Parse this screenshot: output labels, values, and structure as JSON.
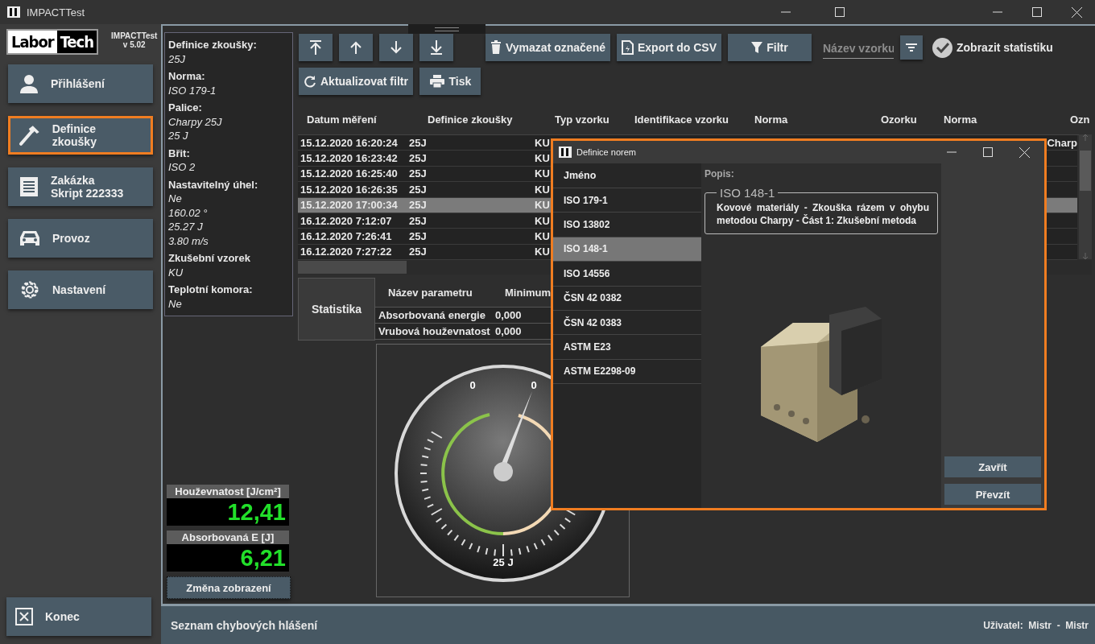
{
  "window": {
    "title": "IMPACTTest"
  },
  "sidebar": {
    "logo": {
      "part1": "Labor",
      "part2": "Tech"
    },
    "app_name": "IMPACTTest",
    "version": "v 5.02",
    "items": [
      {
        "label": "Přihlášení",
        "kind": "user",
        "highlighted": false
      },
      {
        "label": "Definice zkoušky",
        "kind": "hammer",
        "highlighted": true
      },
      {
        "label": "Zakázka",
        "sublabel": "Skript 222333",
        "kind": "document",
        "highlighted": false
      },
      {
        "label": "Provoz",
        "kind": "car",
        "highlighted": false
      },
      {
        "label": "Nastavení",
        "kind": "gear",
        "highlighted": false
      }
    ],
    "exit_button": {
      "label": "Konec",
      "kind": "close"
    }
  },
  "test_info": [
    {
      "label": "Definice zkoušky:",
      "values": [
        "25J"
      ]
    },
    {
      "label": "Norma:",
      "values": [
        "ISO 179-1"
      ]
    },
    {
      "label": "Palice:",
      "values": [
        "Charpy 25J",
        "25 J"
      ]
    },
    {
      "label": "Břit:",
      "values": [
        "ISO 2"
      ]
    },
    {
      "label": "Nastavitelný úhel:",
      "values": [
        "Ne",
        "160.02 °",
        "25.27 J",
        "3.80 m/s"
      ]
    },
    {
      "label": "Zkušební vzorek",
      "values": [
        "KU"
      ]
    },
    {
      "label": "Teplotní komora:",
      "values": [
        "Ne"
      ]
    }
  ],
  "readouts": [
    {
      "label": "Houževnatost [J/cm²]",
      "value": "12,41"
    },
    {
      "label": "Absorbovaná E [J]",
      "value": "6,21"
    }
  ],
  "view_button": {
    "label": "Změna zobrazení"
  },
  "toolbar": {
    "nav_buttons": [
      {
        "kind": "first"
      },
      {
        "kind": "up"
      },
      {
        "kind": "down"
      },
      {
        "kind": "last"
      }
    ],
    "actions": [
      {
        "label": "Vymazat označené",
        "kind": "trash"
      },
      {
        "label": "Export do CSV",
        "kind": "file"
      },
      {
        "label": "Filtr",
        "kind": "funnel"
      }
    ],
    "search": {
      "placeholder": "Název vzorku"
    },
    "statistics_toggle": {
      "label": "Zobrazit statistiku",
      "checked": true
    },
    "actions_row2": [
      {
        "label": "Aktualizovat filtr",
        "kind": "refresh"
      },
      {
        "label": "Tisk",
        "kind": "printer"
      }
    ]
  },
  "table": {
    "columns": [
      "Datum měření",
      "Definice zkoušky",
      "Typ vzorku",
      "Identifikace vzorku",
      "Norma",
      "Ozorku",
      "Norma",
      "Ozn"
    ],
    "rows": [
      {
        "cells": [
          "15.12.2020 16:20:24",
          "25J",
          "KU"
        ],
        "ozn": "Charp",
        "selected": false
      },
      {
        "cells": [
          "15.12.2020 16:23:42",
          "25J",
          "KU"
        ],
        "selected": false
      },
      {
        "cells": [
          "15.12.2020 16:25:40",
          "25J",
          "KU"
        ],
        "selected": false
      },
      {
        "cells": [
          "15.12.2020 16:26:35",
          "25J",
          "KU"
        ],
        "selected": false
      },
      {
        "cells": [
          "15.12.2020 17:00:34",
          "25J",
          "KU"
        ],
        "selected": true
      },
      {
        "cells": [
          "16.12.2020 7:12:07",
          "25J",
          "KU"
        ],
        "selected": false
      },
      {
        "cells": [
          "16.12.2020 7:26:41",
          "25J",
          "KU"
        ],
        "selected": false
      },
      {
        "cells": [
          "16.12.2020 7:27:22",
          "25J",
          "KU"
        ],
        "selected": false
      }
    ]
  },
  "statistics": {
    "title": "Statistika",
    "columns": [
      "Název parametru",
      "Minimum"
    ],
    "rows": [
      [
        "Absorbovaná energie",
        "0,000"
      ],
      [
        "Vrubová houževnatost",
        "0,000"
      ]
    ]
  },
  "gauge": {
    "labels": [
      "0",
      "0"
    ],
    "scale_label": "25 J"
  },
  "dialog": {
    "title": "Definice norem",
    "highlighted": true,
    "list_header": "Jméno",
    "items": [
      {
        "label": "ISO 179-1",
        "selected": false
      },
      {
        "label": "ISO 13802",
        "selected": false
      },
      {
        "label": "ISO 148-1",
        "selected": true
      },
      {
        "label": "ISO 14556",
        "selected": false
      },
      {
        "label": "ČSN 42 0382",
        "selected": false
      },
      {
        "label": "ČSN 42 0383",
        "selected": false
      },
      {
        "label": "ASTM E23",
        "selected": false
      },
      {
        "label": "ASTM E2298-09",
        "selected": false
      }
    ],
    "description_label": "Popis:",
    "group_title": "ISO 148-1",
    "description": "Kovové materiály - Zkouška rázem v ohybu metodou Charpy - Část 1: Zkušební metoda",
    "buttons": [
      "Zavřít",
      "Převzít"
    ]
  },
  "status_bar": {
    "message": "Seznam chybových hlášení",
    "user": "Uživatel:  Mistr  -  Mistr"
  }
}
